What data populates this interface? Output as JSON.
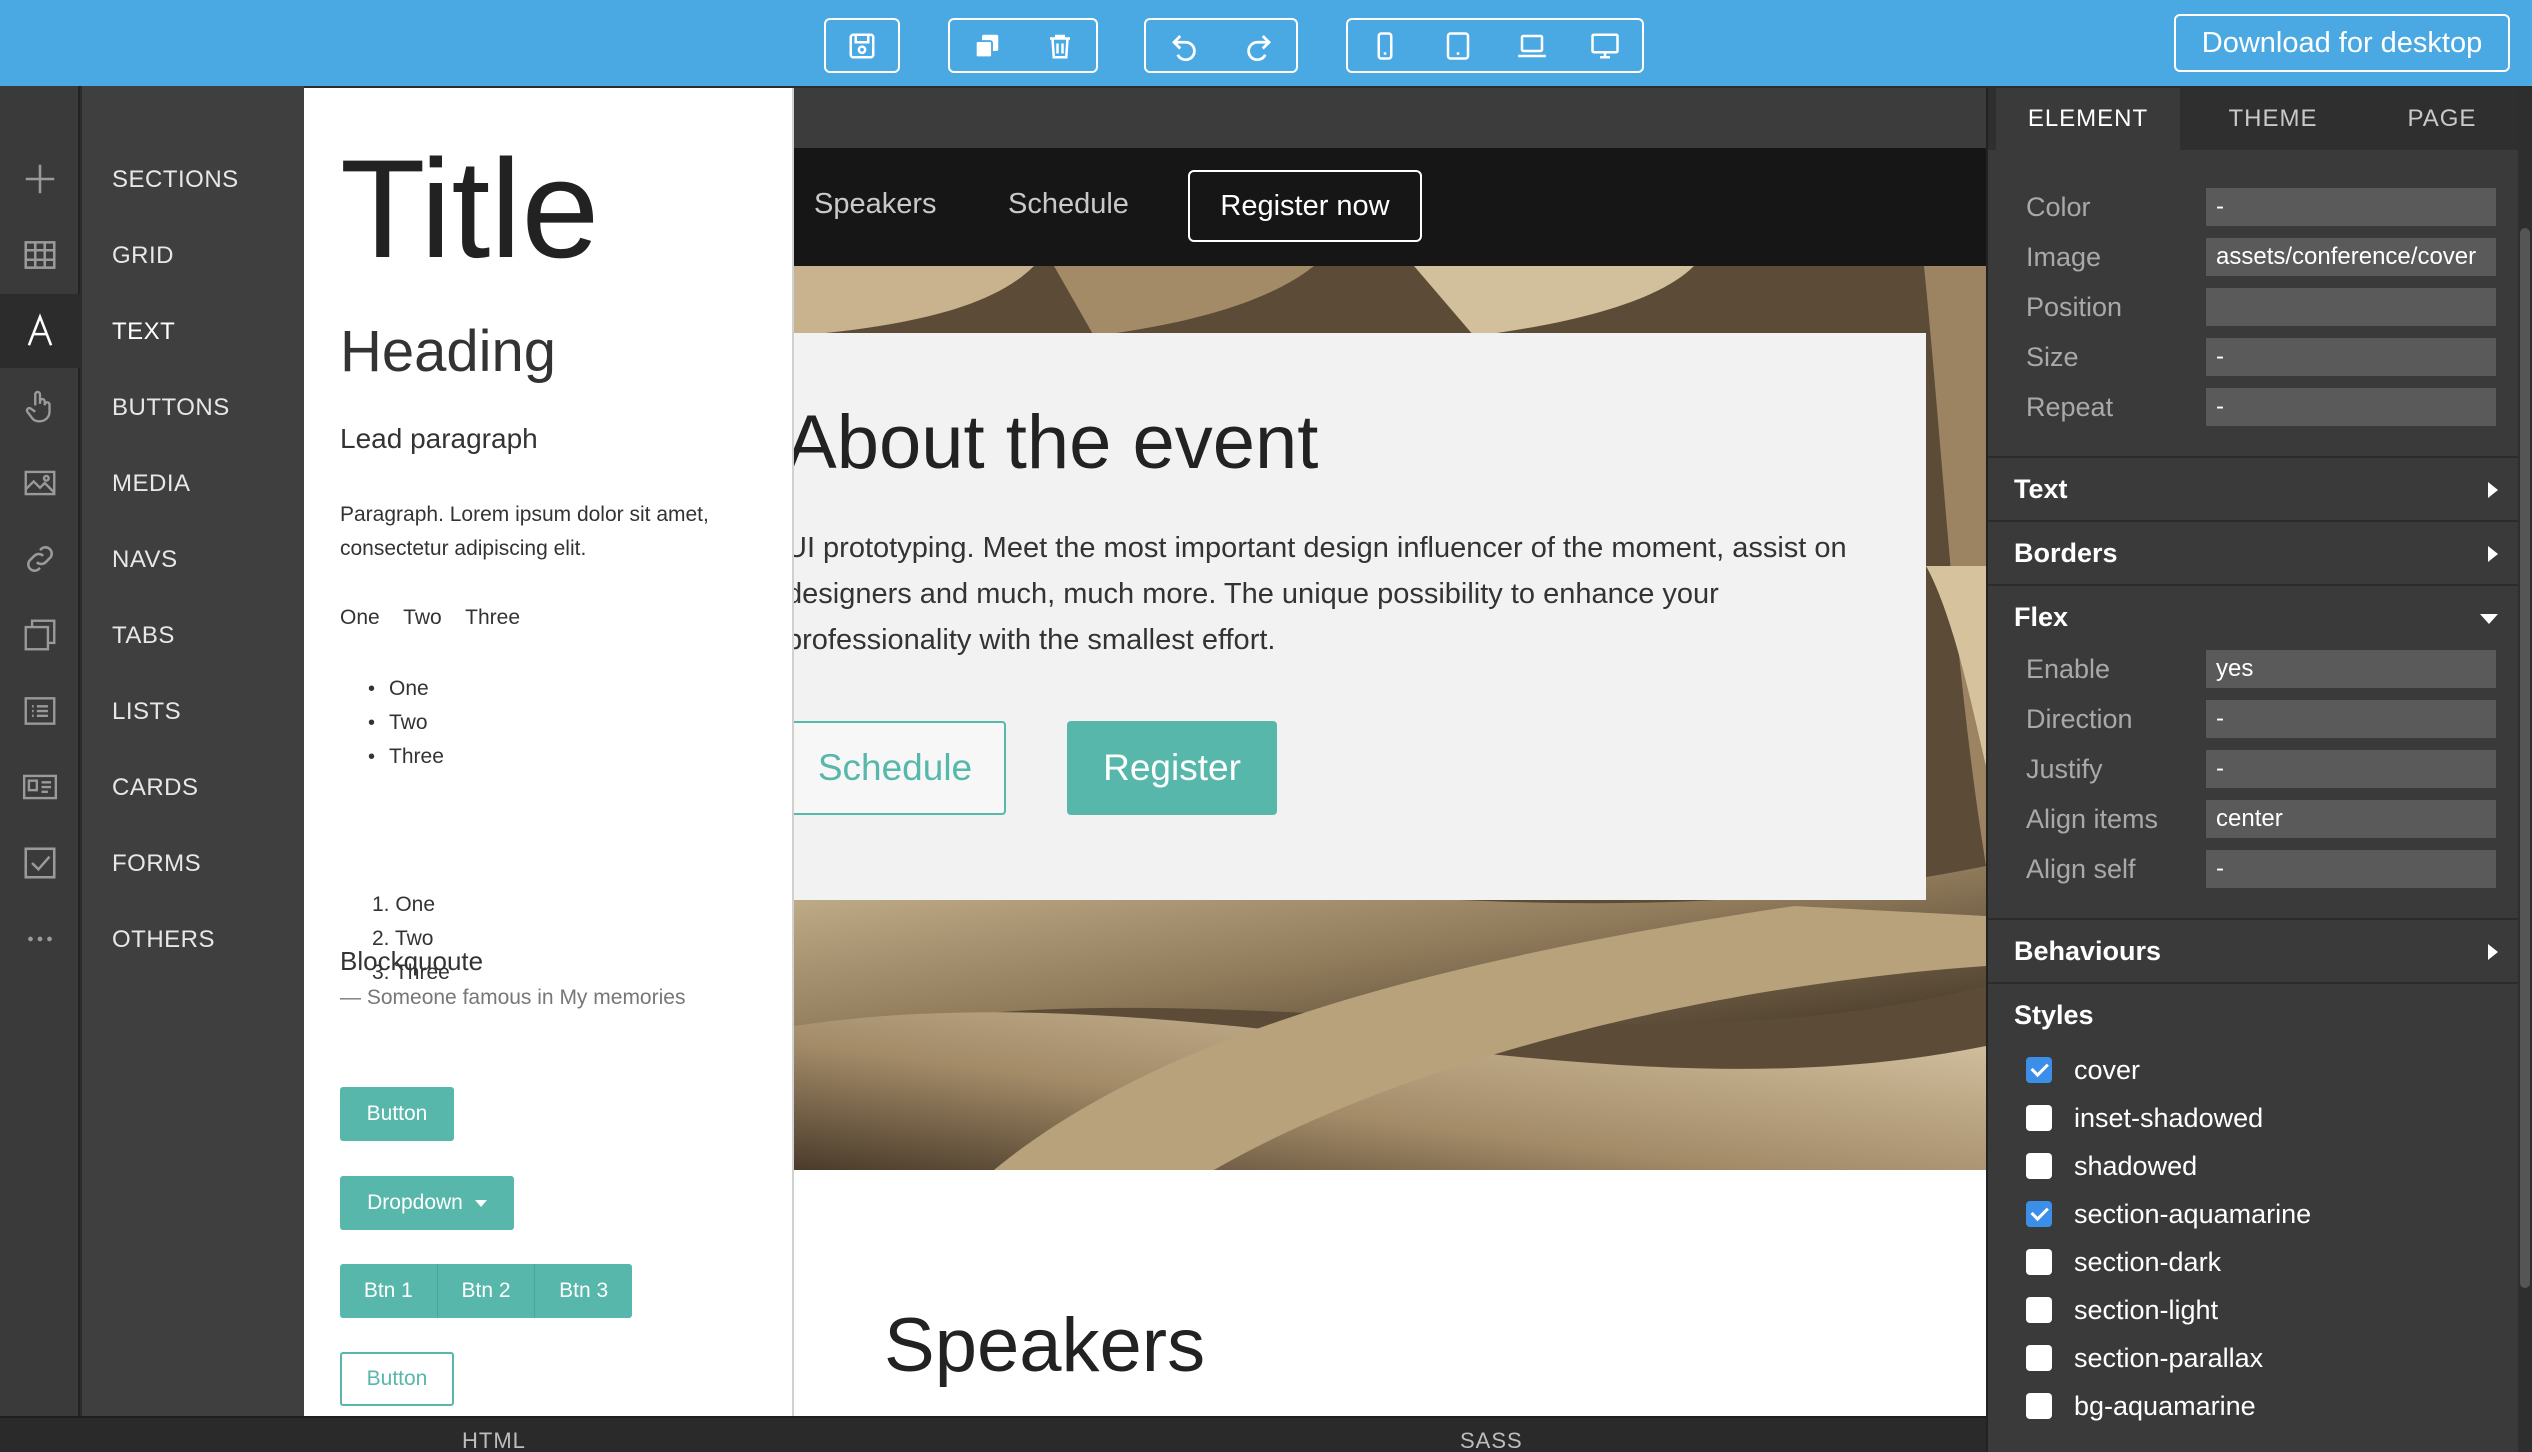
{
  "toolbar": {
    "download_label": "Download for desktop",
    "groups": [
      {
        "icons": [
          "save-icon"
        ]
      },
      {
        "icons": [
          "duplicate-icon",
          "trash-icon"
        ]
      },
      {
        "icons": [
          "undo-icon",
          "redo-icon"
        ]
      },
      {
        "icons": [
          "mobile-icon",
          "tablet-icon",
          "laptop-icon",
          "desktop-icon"
        ]
      }
    ]
  },
  "rail": {
    "icons": [
      "plus-icon",
      "grid-icon",
      "text-icon",
      "pointer-hand-icon",
      "image-icon",
      "link-icon",
      "tabs-icon",
      "list-icon",
      "card-icon",
      "checkbox-icon",
      "more-icon"
    ],
    "active_index": 2
  },
  "categories": [
    "SECTIONS",
    "GRID",
    "TEXT",
    "BUTTONS",
    "MEDIA",
    "NAVS",
    "TABS",
    "LISTS",
    "CARDS",
    "FORMS",
    "OTHERS"
  ],
  "text_panel": {
    "title": "Title",
    "heading": "Heading",
    "lead": "Lead paragraph",
    "paragraph": "Paragraph. Lorem ipsum dolor sit amet, consectetur adipiscing elit.",
    "inline_items": [
      "One",
      "Two",
      "Three"
    ],
    "unordered": [
      "One",
      "Two",
      "Three"
    ],
    "ordered": [
      "1. One",
      "2. Two",
      "3. Three"
    ],
    "blockquote": "Blockquoute",
    "blockquote_footer": "— Someone famous in My memories",
    "button": "Button",
    "dropdown": "Dropdown",
    "btn_group": [
      "Btn 1",
      "Btn 2",
      "Btn 3"
    ],
    "outline_button": "Button"
  },
  "canvas": {
    "nav_links": [
      "Speakers",
      "Schedule"
    ],
    "nav_register": "Register now",
    "about_title": "About the event",
    "about_text": "UI prototyping. Meet the most important design influencer of the moment, assist on designers and much, much more. The unique possibility to enhance your professionality with the smallest effort.",
    "schedule_btn": "Schedule",
    "register_btn": "Register",
    "speakers_title": "Speakers",
    "accent_color": "#57b7ab"
  },
  "bottom_bar": {
    "html_label": "HTML",
    "sass_label": "SASS"
  },
  "props": {
    "tabs": [
      "ELEMENT",
      "THEME",
      "PAGE"
    ],
    "active_tab": "ELEMENT",
    "background": {
      "fields": [
        {
          "label": "Color",
          "value": "-"
        },
        {
          "label": "Image",
          "value": "assets/conference/cover"
        },
        {
          "label": "Position",
          "value": ""
        },
        {
          "label": "Size",
          "value": "-"
        },
        {
          "label": "Repeat",
          "value": "-"
        }
      ]
    },
    "sections": {
      "text": "Text",
      "borders": "Borders",
      "flex": "Flex",
      "behaviours": "Behaviours",
      "styles": "Styles"
    },
    "flex_fields": [
      {
        "label": "Enable",
        "value": "yes"
      },
      {
        "label": "Direction",
        "value": "-"
      },
      {
        "label": "Justify",
        "value": "-"
      },
      {
        "label": "Align items",
        "value": "center"
      },
      {
        "label": "Align self",
        "value": "-"
      }
    ],
    "styles": [
      {
        "label": "cover",
        "checked": true
      },
      {
        "label": "inset-shadowed",
        "checked": false
      },
      {
        "label": "shadowed",
        "checked": false
      },
      {
        "label": "section-aquamarine",
        "checked": true
      },
      {
        "label": "section-dark",
        "checked": false
      },
      {
        "label": "section-light",
        "checked": false
      },
      {
        "label": "section-parallax",
        "checked": false
      },
      {
        "label": "bg-aquamarine",
        "checked": false
      }
    ]
  }
}
